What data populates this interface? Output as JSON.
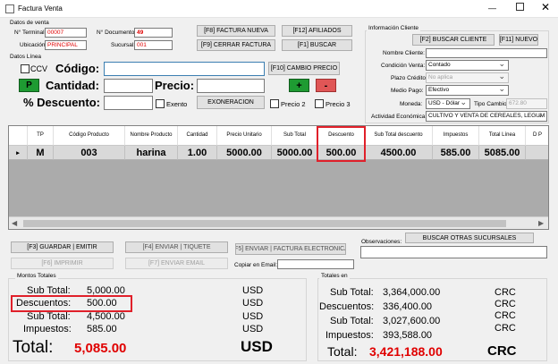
{
  "window": {
    "title": "Factura Venta"
  },
  "datos_venta": {
    "group_label": "Datos de venta",
    "terminal_label": "N° Terminal:",
    "terminal_value": "00007",
    "documento_label": "N° Documento:",
    "documento_value": "49",
    "ubicacion_label": "Ubicación:",
    "ubicacion_value": "PRINCIPAL",
    "sucursal_label": "Sucursal:",
    "sucursal_value": "001"
  },
  "top_buttons": {
    "factura_nueva": "[F8] FACTURA NUEVA",
    "afiliados": "[F12] AFILIADOS",
    "cerrar_factura": "[F9] CERRAR FACTURA",
    "buscar": "[F1] BUSCAR"
  },
  "datos_linea": {
    "group_label": "Datos Línea",
    "ccv_label": "CCV",
    "codigo_label": "Código:",
    "codigo_value": "",
    "cambio_precio": "[F10] CAMBIO PRECIO",
    "p_button": "P",
    "cantidad_label": "Cantidad:",
    "cantidad_value": "",
    "precio_label": "Precio:",
    "precio_value": "",
    "plus_button": "+",
    "minus_button": "-",
    "descuento_label": "% Descuento:",
    "descuento_value": "",
    "exento_label": "Exento",
    "exoneracion": "EXONERACION",
    "precio2_label": "Precio 2",
    "precio3_label": "Precio 3"
  },
  "cliente": {
    "group_label": "Información Cliente",
    "buscar_cliente": "[F2] BUSCAR CLIENTE",
    "nuevo": "[F11] NUEVO",
    "nombre_label": "Nombre Cliente:",
    "nombre_value": "",
    "condicion_label": "Condición Venta:",
    "condicion_value": "Contado",
    "plazo_label": "Plazo Crédito:",
    "plazo_value": "No aplica",
    "medio_label": "Medio Pago:",
    "medio_value": "Efectivo",
    "moneda_label": "Moneda:",
    "moneda_value": "USD - Dólar",
    "tipo_cambio_label": "Tipo Cambio:",
    "tipo_cambio_value": "672.80",
    "actividad_label": "Actividad Económica:",
    "actividad_value": "CULTIVO Y VENTA DE CEREALES, LEGUM"
  },
  "table": {
    "headers": [
      "TP",
      "Código Producto",
      "Nombre Producto",
      "Cantidad",
      "Precio Unitario",
      "Sub Total",
      "Descuento",
      "Sub Total descuento",
      "Impuestos",
      "Total Línea",
      "D P"
    ],
    "rows": [
      {
        "marker": "▸",
        "cells": [
          "M",
          "003",
          "harina",
          "1.00",
          "5000.00",
          "5000.00",
          "500.00",
          "4500.00",
          "585.00",
          "5085.00",
          ""
        ]
      }
    ]
  },
  "actions": {
    "guardar_emitir": "[F3] GUARDAR | EMITIR",
    "enviar_tiquete": "[F4] ENVIAR | TIQUETE",
    "enviar_factura": "[F5] ENVIAR | FACTURA ELECTRONICA",
    "imprimir": "[F6] IMPRIMIR",
    "enviar_email": "[F7] ENVIAR EMAIL",
    "copiar_email_label": "Copiar en Email:",
    "copiar_email_value": "",
    "buscar_sucursales": "BUSCAR OTRAS SUCURSALES",
    "observaciones_label": "Observaciones:",
    "observaciones_value": ""
  },
  "montos": {
    "group_label": "Montos Totales",
    "subtotal_label": "Sub Total:",
    "subtotal_value": "5,000.00",
    "subtotal_cur": "USD",
    "descuentos_label": "Descuentos:",
    "descuentos_value": "500.00",
    "descuentos_cur": "USD",
    "subtotal2_label": "Sub Total:",
    "subtotal2_value": "4,500.00",
    "subtotal2_cur": "USD",
    "impuestos_label": "Impuestos:",
    "impuestos_value": "585.00",
    "impuestos_cur": "USD",
    "total_label": "Total:",
    "total_value": "5,085.00",
    "total_cur": "USD"
  },
  "totales_en": {
    "group_label": "Totales en",
    "subtotal_label": "Sub Total:",
    "subtotal_value": "3,364,000.00",
    "subtotal_cur": "CRC",
    "descuentos_label": "Descuentos:",
    "descuentos_value": "336,400.00",
    "descuentos_cur": "CRC",
    "subtotal2_label": "Sub Total:",
    "subtotal2_value": "3,027,600.00",
    "subtotal2_cur": "CRC",
    "impuestos_label": "Impuestos:",
    "impuestos_value": "393,588.00",
    "impuestos_cur": "CRC",
    "total_label": "Total:",
    "total_value": "3,421,188.00",
    "total_cur": "CRC"
  },
  "colors": {
    "accent_red": "#e00000",
    "green_button": "#1e9b32",
    "red_button": "#e05656",
    "highlight": "#e0202a"
  }
}
